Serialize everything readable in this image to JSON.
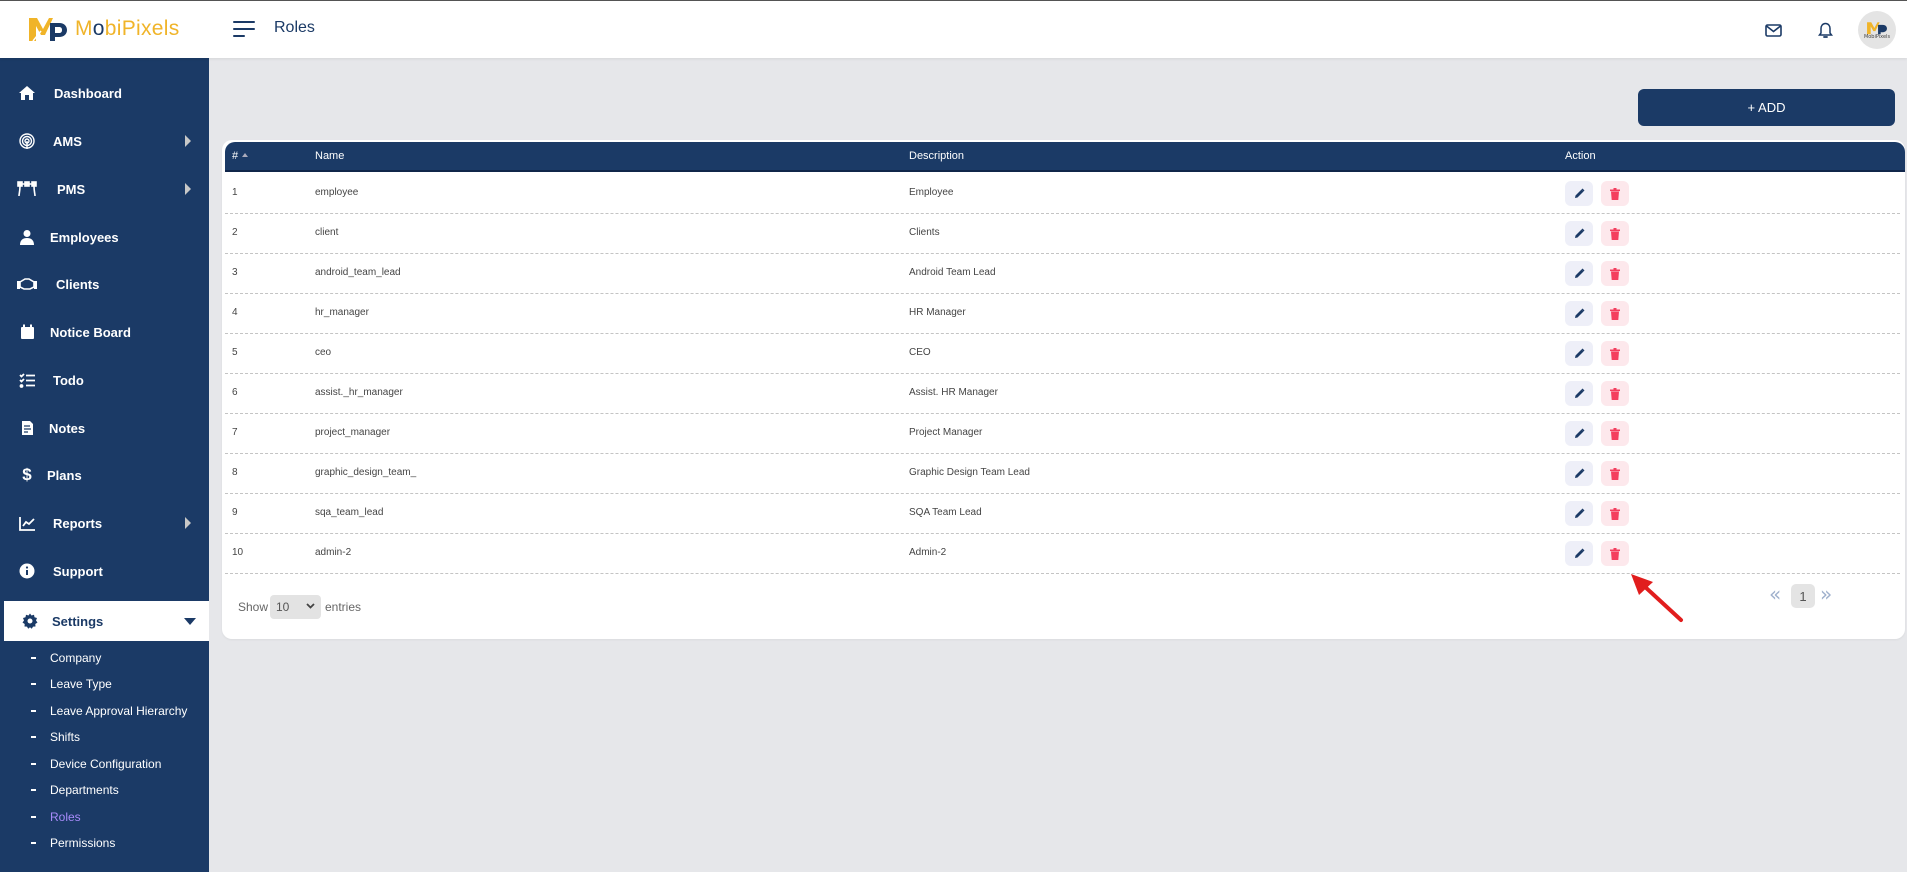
{
  "header": {
    "brand": "MobiPixels",
    "brand_prefix": "M",
    "brand_o": "o",
    "brand_suffix": "biPixels",
    "title": "Roles",
    "avatar_text": "MobiPixels"
  },
  "sidebar": {
    "items": [
      {
        "label": "Dashboard",
        "icon": "home-icon",
        "has_arrow": false
      },
      {
        "label": "AMS",
        "icon": "fingerprint-icon",
        "has_arrow": true
      },
      {
        "label": "PMS",
        "icon": "bezier-icon",
        "has_arrow": true
      },
      {
        "label": "Employees",
        "icon": "user-icon",
        "has_arrow": false
      },
      {
        "label": "Clients",
        "icon": "handshake-icon",
        "has_arrow": false
      },
      {
        "label": "Notice Board",
        "icon": "calendar-icon",
        "has_arrow": false
      },
      {
        "label": "Todo",
        "icon": "checklist-icon",
        "has_arrow": false
      },
      {
        "label": "Notes",
        "icon": "document-icon",
        "has_arrow": false
      },
      {
        "label": "Plans",
        "icon": "dollar-icon",
        "has_arrow": false
      },
      {
        "label": "Reports",
        "icon": "chart-line-icon",
        "has_arrow": true
      },
      {
        "label": "Support",
        "icon": "info-icon",
        "has_arrow": false
      },
      {
        "label": "Settings",
        "icon": "gear-icon",
        "has_arrow": false,
        "expanded": true
      }
    ],
    "settings_sub": [
      {
        "label": "Company"
      },
      {
        "label": "Leave Type"
      },
      {
        "label": "Leave Approval Hierarchy"
      },
      {
        "label": "Shifts"
      },
      {
        "label": "Device Configuration"
      },
      {
        "label": "Departments"
      },
      {
        "label": "Roles",
        "current": true
      },
      {
        "label": "Permissions"
      }
    ]
  },
  "toolbar": {
    "add_label": "+ ADD"
  },
  "table": {
    "columns": [
      "#",
      "Name",
      "Description",
      "Action"
    ],
    "rows": [
      {
        "num": "1",
        "name": "employee",
        "desc": "Employee"
      },
      {
        "num": "2",
        "name": "client",
        "desc": "Clients"
      },
      {
        "num": "3",
        "name": "android_team_lead",
        "desc": "Android Team Lead"
      },
      {
        "num": "4",
        "name": "hr_manager",
        "desc": "HR Manager"
      },
      {
        "num": "5",
        "name": "ceo",
        "desc": "CEO"
      },
      {
        "num": "6",
        "name": "assist._hr_manager",
        "desc": "Assist. HR Manager"
      },
      {
        "num": "7",
        "name": "project_manager",
        "desc": "Project Manager"
      },
      {
        "num": "8",
        "name": "graphic_design_team_",
        "desc": "Graphic Design Team Lead"
      },
      {
        "num": "9",
        "name": "sqa_team_lead",
        "desc": "SQA Team Lead"
      },
      {
        "num": "10",
        "name": "admin-2",
        "desc": "Admin-2"
      }
    ]
  },
  "footer": {
    "show_label": "Show",
    "entries_value": "10",
    "entries_label": "entries",
    "prev": "«",
    "current_page": "1",
    "next": "»"
  },
  "colors": {
    "primary": "#1b3a66",
    "accent": "#f0b429",
    "danger": "#f43f5e",
    "active_sub": "#a78bfa",
    "annotation": "#e11d1d"
  }
}
